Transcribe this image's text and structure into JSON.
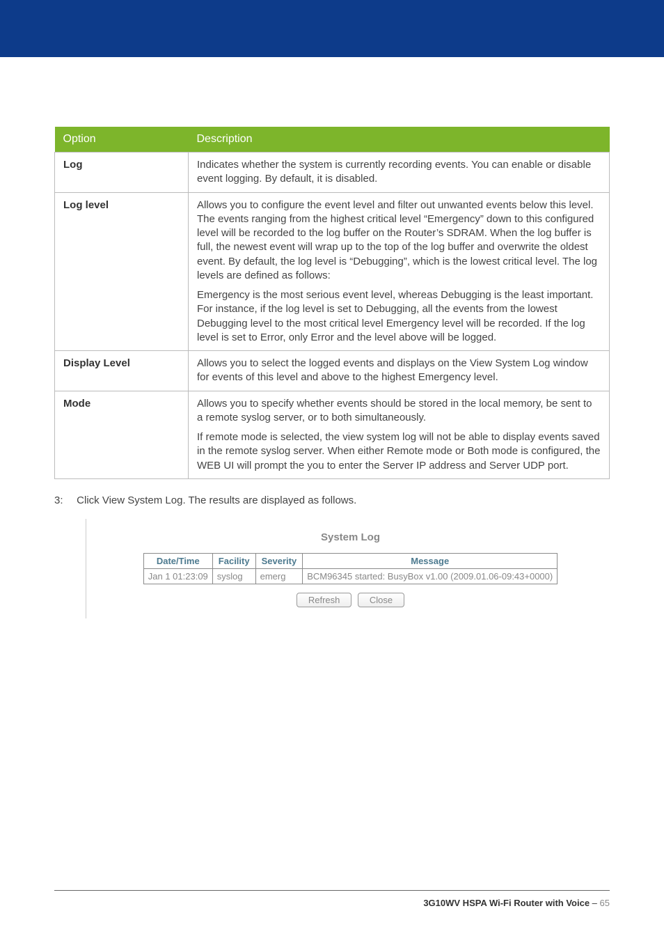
{
  "table": {
    "headers": {
      "option": "Option",
      "description": "Description"
    },
    "rows": [
      {
        "option": "Log",
        "p1": "Indicates whether the system is currently recording events. You can enable or disable event logging. By default, it is disabled."
      },
      {
        "option": "Log level",
        "p1": "Allows you to configure the event level and filter out unwanted events below this level. The events ranging from the highest critical level “Emergency” down to this configured level will be recorded to the log buffer on the Router’s SDRAM. When the log buffer is full, the newest event will wrap up to the top of the log buffer and overwrite the oldest event. By default, the log level is “Debugging”, which is the lowest critical level. The log levels are defined as follows:",
        "p2": "Emergency is the most serious event level, whereas Debugging is the least important. For instance, if the log level is set to Debugging, all the events from the lowest Debugging level to the most critical level Emergency level will be recorded. If the log level is set to Error, only Error and the level above will be logged."
      },
      {
        "option": "Display Level",
        "p1": "Allows you to select the logged events and displays on the View System Log window for events of this level and above to the highest Emergency level."
      },
      {
        "option": "Mode",
        "p1": "Allows you to specify whether events should be stored in the local memory, be sent to a remote syslog server, or to both simultaneously.",
        "p2": "If remote mode is selected, the view system log will not be able to display events saved in the remote syslog server. When either Remote mode or Both mode is configured, the WEB UI will prompt the you to enter the Server IP address and Server UDP port."
      }
    ]
  },
  "step": {
    "num": "3:",
    "text": "Click View System Log. The results are displayed as follows."
  },
  "syslog": {
    "title": "System Log",
    "headers": {
      "dt": "Date/Time",
      "fac": "Facility",
      "sev": "Severity",
      "msg": "Message"
    },
    "row": {
      "dt": "Jan 1 01:23:09",
      "fac": "syslog",
      "sev": "emerg",
      "msg": "BCM96345 started: BusyBox v1.00 (2009.01.06-09:43+0000)"
    },
    "buttons": {
      "refresh": "Refresh",
      "close": "Close"
    }
  },
  "footer": {
    "product": "3G10WV HSPA Wi-Fi Router with Voice",
    "sep": " – ",
    "page": "65"
  }
}
